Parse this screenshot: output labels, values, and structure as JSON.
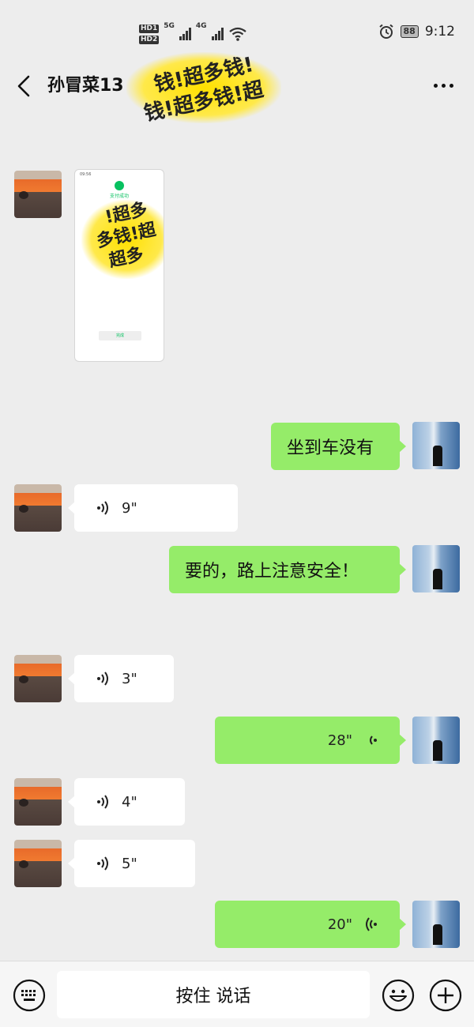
{
  "status_bar": {
    "hd1": "HD1",
    "hd2": "HD2",
    "net1": "5G",
    "net2": "4G",
    "battery": "88",
    "time": "9:12"
  },
  "header": {
    "title": "孙冒菜13",
    "sticker_line1": "钱!超多钱!",
    "sticker_line2": "钱!超多钱!超"
  },
  "image_message": {
    "mini_status": "09:56",
    "pay_text": "支付成功",
    "done_label": "完成",
    "sticker_line1": "!超多",
    "sticker_line2": "多钱!超",
    "sticker_line3": "超多"
  },
  "messages": [
    {
      "side": "in",
      "type": "image"
    },
    {
      "side": "out",
      "type": "text",
      "text": "坐到车没有"
    },
    {
      "side": "in",
      "type": "voice",
      "duration": "9\""
    },
    {
      "side": "out",
      "type": "text",
      "text": "要的，路上注意安全！"
    },
    {
      "side": "in",
      "type": "voice",
      "duration": "3\""
    },
    {
      "side": "out",
      "type": "voice",
      "duration": "28\""
    },
    {
      "side": "in",
      "type": "voice",
      "duration": "4\""
    },
    {
      "side": "in",
      "type": "voice",
      "duration": "5\""
    },
    {
      "side": "out",
      "type": "voice",
      "duration": "20\""
    }
  ],
  "input_bar": {
    "talk_label": "按住 说话"
  },
  "icons": {
    "back": "back-arrow-icon",
    "more": "more-icon",
    "keyboard": "keyboard-icon",
    "emoji": "emoji-icon",
    "plus": "plus-icon",
    "voice": "voice-wave-icon"
  },
  "colors": {
    "background": "#ededed",
    "out_bubble": "#95ec69",
    "in_bubble": "#ffffff",
    "sticker": "#ffe000"
  }
}
